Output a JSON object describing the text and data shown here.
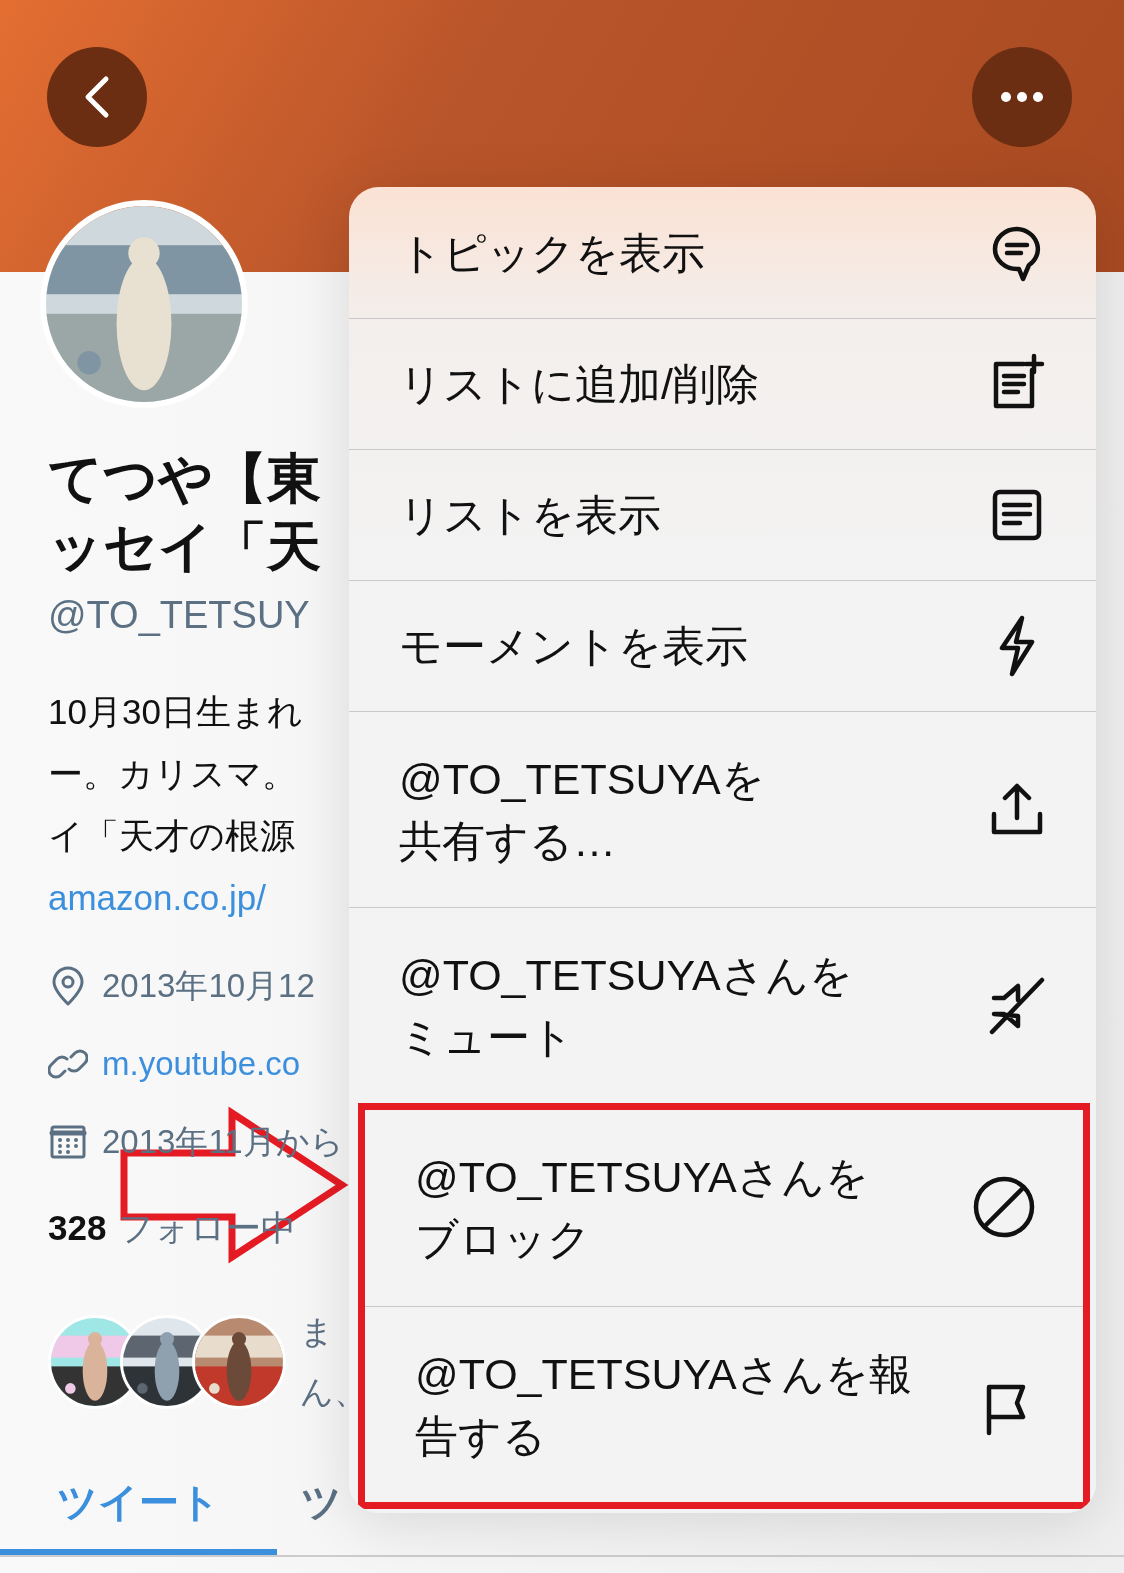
{
  "profile": {
    "name_lines": [
      "てつや【東",
      "ッセイ「天"
    ],
    "handle": "@TO_TETSUY",
    "bio_lines": [
      "10月30日生まれ",
      "ー。カリスマ。",
      "イ「天才の根源"
    ],
    "bio_link": "amazon.co.jp/",
    "meta": [
      {
        "kind": "location",
        "text": "2013年10月12"
      },
      {
        "kind": "link",
        "text": "m.youtube.co"
      },
      {
        "kind": "joined",
        "text": "2013年11月から"
      }
    ],
    "following": {
      "count": "328",
      "label": "フォロー中"
    },
    "followers_you_know": {
      "avatars": [
        {
          "kind": "picture"
        },
        {
          "kind": "picture"
        },
        {
          "kind": "picture"
        }
      ],
      "text_lines": [
        "ま",
        "ん、"
      ]
    }
  },
  "tabs": [
    {
      "label": "ツイート",
      "selected": true
    },
    {
      "label": "ツ",
      "selected": false
    }
  ],
  "menu": {
    "items": [
      {
        "kind": "topic",
        "lines": [
          "トピックを表示"
        ],
        "highlighted": false
      },
      {
        "kind": "list-add",
        "lines": [
          "リストに追加/削除"
        ],
        "highlighted": false
      },
      {
        "kind": "list",
        "lines": [
          "リストを表示"
        ],
        "highlighted": false
      },
      {
        "kind": "moment",
        "lines": [
          "モーメントを表示"
        ],
        "highlighted": false
      },
      {
        "kind": "share",
        "lines": [
          "@TO_TETSUYAを",
          "共有する…"
        ],
        "highlighted": false
      },
      {
        "kind": "mute",
        "lines": [
          "@TO_TETSUYAさんを",
          "ミュート"
        ],
        "highlighted": false
      },
      {
        "kind": "block",
        "lines": [
          "@TO_TETSUYAさんを",
          "ブロック"
        ],
        "highlighted": true
      },
      {
        "kind": "report",
        "lines": [
          "@TO_TETSUYAさんを報",
          "告する"
        ],
        "highlighted": true
      }
    ]
  },
  "annotations": [
    {
      "kind": "arrow"
    }
  ]
}
